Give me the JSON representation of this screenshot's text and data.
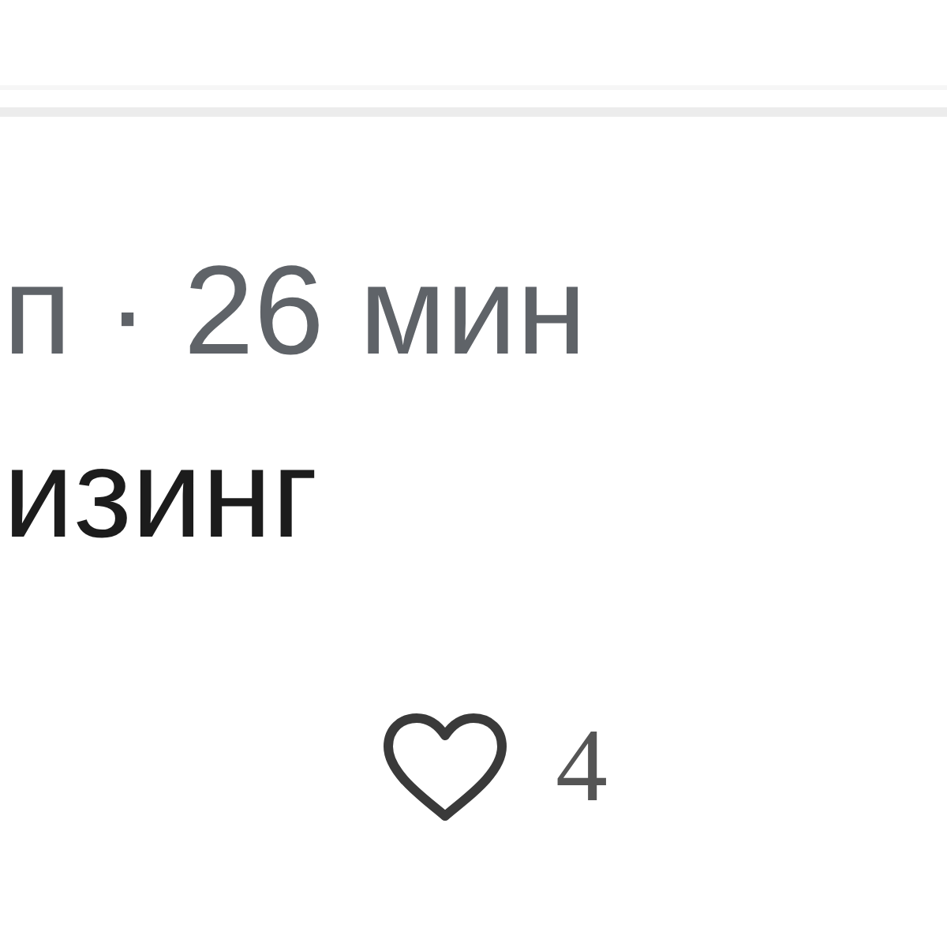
{
  "post": {
    "meta": "п · 26 мин",
    "text": "изинг",
    "like": {
      "liked": false,
      "count": "4"
    }
  }
}
